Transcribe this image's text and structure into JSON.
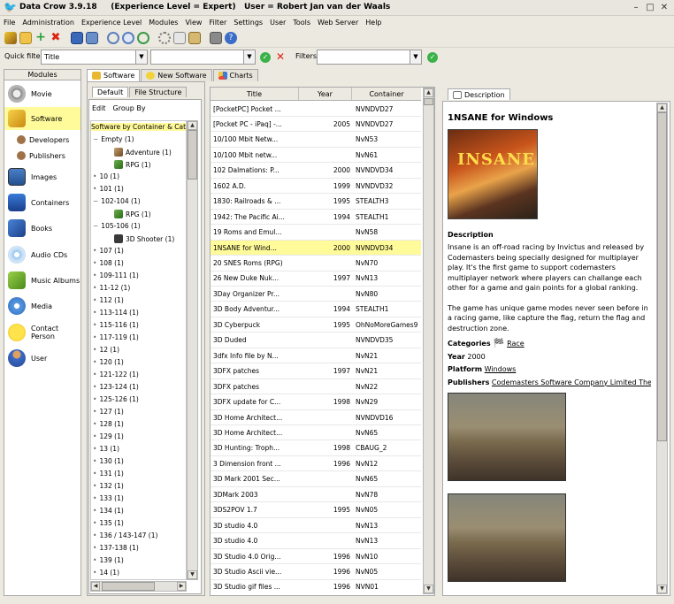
{
  "window": {
    "title": "Data Crow 3.9.18     (Experience Level = Expert)   User = Robert Jan van der Waals"
  },
  "menu": [
    "File",
    "Administration",
    "Experience Level",
    "Modules",
    "View",
    "Filter",
    "Settings",
    "User",
    "Tools",
    "Web Server",
    "Help"
  ],
  "filterbar": {
    "quick_filter_label": "Quick filter",
    "quick_filter_field": "Title",
    "quick_filter_value": "",
    "filters_label": "Filters",
    "filters_value": ""
  },
  "modules": {
    "header": "Modules",
    "items": [
      {
        "label": "Movie",
        "icon": "movie-reel-icon"
      },
      {
        "label": "Software",
        "icon": "software-disk-icon"
      },
      {
        "label": "Developers",
        "icon": "developer-person-icon"
      },
      {
        "label": "Publishers",
        "icon": "publisher-person-icon"
      },
      {
        "label": "Images",
        "icon": "images-icon"
      },
      {
        "label": "Containers",
        "icon": "containers-icon"
      },
      {
        "label": "Books",
        "icon": "books-icon"
      },
      {
        "label": "Audio CDs",
        "icon": "audio-cd-icon"
      },
      {
        "label": "Music Albums",
        "icon": "music-album-icon"
      },
      {
        "label": "Media",
        "icon": "media-icon"
      },
      {
        "label": "Contact Person",
        "icon": "contact-smiley-icon"
      },
      {
        "label": "User",
        "icon": "user-icon"
      }
    ]
  },
  "tabs": {
    "software": "Software",
    "new_software": "New Software",
    "charts": "Charts",
    "default": "Default",
    "file_structure": "File Structure",
    "description": "Description"
  },
  "tree": {
    "menu": [
      "Edit",
      "Group By"
    ],
    "root": "Software by Container & Category",
    "nodes": [
      {
        "label": "Empty (1)",
        "level": 1
      },
      {
        "label": "Adventure (1)",
        "level": 2
      },
      {
        "label": "RPG (1)",
        "level": 2
      },
      {
        "label": "10 (1)",
        "level": 1
      },
      {
        "label": "101 (1)",
        "level": 1
      },
      {
        "label": "102-104 (1)",
        "level": 1
      },
      {
        "label": "RPG (1)",
        "level": 2
      },
      {
        "label": "105-106 (1)",
        "level": 1
      },
      {
        "label": "3D Shooter (1)",
        "level": 2
      },
      {
        "label": "107 (1)",
        "level": 1
      },
      {
        "label": "108 (1)",
        "level": 1
      },
      {
        "label": "109-111 (1)",
        "level": 1
      },
      {
        "label": "11-12 (1)",
        "level": 1
      },
      {
        "label": "112 (1)",
        "level": 1
      },
      {
        "label": "113-114 (1)",
        "level": 1
      },
      {
        "label": "115-116 (1)",
        "level": 1
      },
      {
        "label": "117-119 (1)",
        "level": 1
      },
      {
        "label": "12 (1)",
        "level": 1
      },
      {
        "label": "120 (1)",
        "level": 1
      },
      {
        "label": "121-122 (1)",
        "level": 1
      },
      {
        "label": "123-124 (1)",
        "level": 1
      },
      {
        "label": "125-126 (1)",
        "level": 1
      },
      {
        "label": "127 (1)",
        "level": 1
      },
      {
        "label": "128 (1)",
        "level": 1
      },
      {
        "label": "129 (1)",
        "level": 1
      },
      {
        "label": "13 (1)",
        "level": 1
      },
      {
        "label": "130 (1)",
        "level": 1
      },
      {
        "label": "131 (1)",
        "level": 1
      },
      {
        "label": "132 (1)",
        "level": 1
      },
      {
        "label": "133 (1)",
        "level": 1
      },
      {
        "label": "134 (1)",
        "level": 1
      },
      {
        "label": "135 (1)",
        "level": 1
      },
      {
        "label": "136 / 143-147 (1)",
        "level": 1
      },
      {
        "label": "137-138 (1)",
        "level": 1
      },
      {
        "label": "139 (1)",
        "level": 1
      },
      {
        "label": "14 (1)",
        "level": 1
      },
      {
        "label": "140 (1)",
        "level": 1
      }
    ]
  },
  "list": {
    "columns": [
      "Title",
      "Year",
      "Container"
    ],
    "rows": [
      [
        "[PocketPC] Pocket ...",
        "",
        "NVNDVD27"
      ],
      [
        "[Pocket PC - iPaq] -...",
        "2005",
        "NVNDVD27"
      ],
      [
        "10/100 Mbit Netw...",
        "",
        "NvN53"
      ],
      [
        "10/100 Mbit netw...",
        "",
        "NvN61"
      ],
      [
        "102 Dalmations: P...",
        "2000",
        "NVNDVD34"
      ],
      [
        "1602 A.D.",
        "1999",
        "NVNDVD32"
      ],
      [
        "1830: Railroads & ...",
        "1995",
        "STEALTH3"
      ],
      [
        "1942: The Pacific Ai...",
        "1994",
        "STEALTH1"
      ],
      [
        "19 Roms and Emul...",
        "",
        "NvN58"
      ],
      [
        "1NSANE for Wind...",
        "2000",
        "NVNDVD34"
      ],
      [
        "20 SNES Roms (RPG)",
        "",
        "NvN70"
      ],
      [
        "26 New Duke Nuk...",
        "1997",
        "NvN13"
      ],
      [
        "3Day Organizer Pr...",
        "",
        "NvN80"
      ],
      [
        "3D Body Adventur...",
        "1994",
        "STEALTH1"
      ],
      [
        "3D Cyberpuck",
        "1995",
        "OhNoMoreGames9"
      ],
      [
        "3D Duded",
        "",
        "NVNDVD35"
      ],
      [
        "3dfx Info file by N...",
        "",
        "NvN21"
      ],
      [
        "3DFX patches",
        "1997",
        "NvN21"
      ],
      [
        "3DFX patches",
        "",
        "NvN22"
      ],
      [
        "3DFX update for C...",
        "1998",
        "NvN29"
      ],
      [
        "3D Home Architect...",
        "",
        "NVNDVD16"
      ],
      [
        "3D Home Architect...",
        "",
        "NvN65"
      ],
      [
        "3D Hunting: Troph...",
        "1998",
        "CBAUG_2"
      ],
      [
        "3 Dimension front ...",
        "1996",
        "NvN12"
      ],
      [
        "3D Mark 2001 Sec...",
        "",
        "NvN65"
      ],
      [
        "3DMark 2003",
        "",
        "NvN78"
      ],
      [
        "3DS2POV 1.7",
        "1995",
        "NvN05"
      ],
      [
        "3D studio 4.0",
        "",
        "NvN13"
      ],
      [
        "3D studio 4.0",
        "",
        "NvN13"
      ],
      [
        "3D Studio 4.0 Orig...",
        "1996",
        "NvN10"
      ],
      [
        "3D Studio Ascii vie...",
        "1996",
        "NvN05"
      ],
      [
        "3D Studio gif files ...",
        "1996",
        "NVN01"
      ]
    ],
    "selected_index": 9
  },
  "description": {
    "title": "1NSANE for Windows",
    "section_label": "Description",
    "paragraph1": "Insane is an off-road racing by Invictus and released by Codemasters being specially designed for multiplayer play. It's the first game to support codemasters multiplayer network where players can challange each other for a game and gain points for a global ranking.",
    "paragraph2": "The game has unique game modes never seen before in a racing game, like capture the flag, return the flag and destruction zone.",
    "categories_label": "Categories",
    "categories_value": "Race",
    "year_label": "Year",
    "year_value": "2000",
    "platform_label": "Platform",
    "platform_value": "Windows",
    "publishers_label": "Publishers",
    "publishers_value": "Codemasters Software Company Limited The",
    "cover_text": "INSANE"
  }
}
